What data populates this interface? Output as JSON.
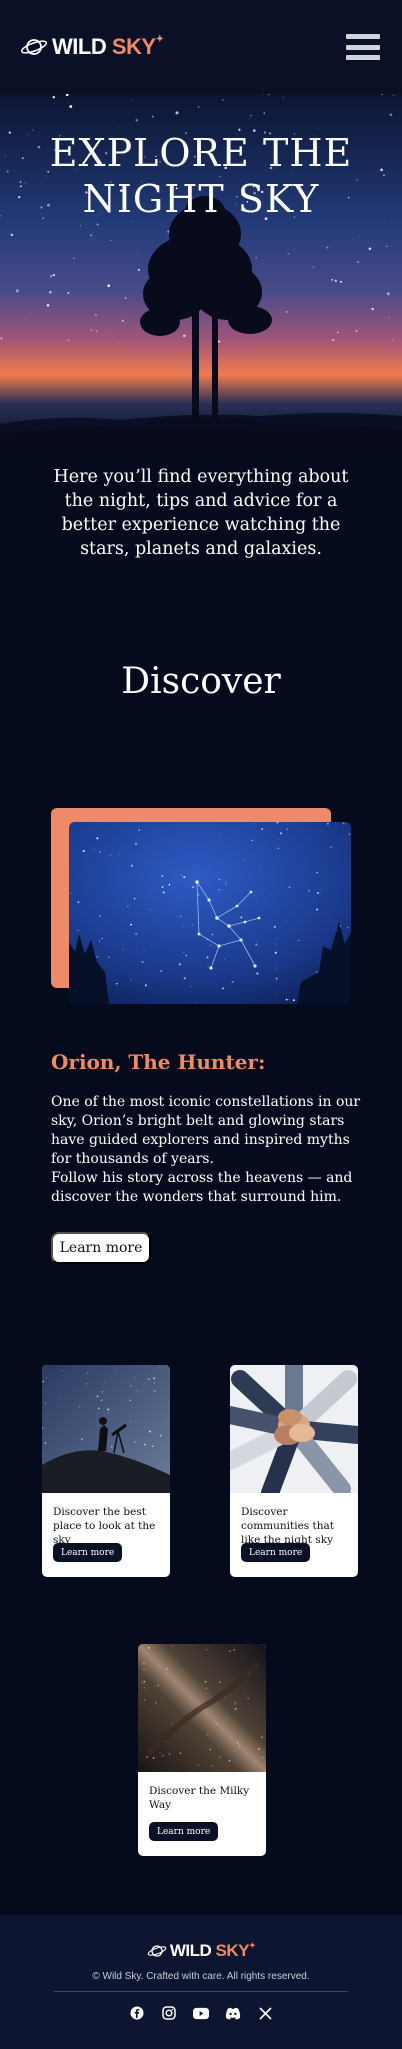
{
  "brand": {
    "first": "WILD",
    "second": "SKY"
  },
  "hero": {
    "title_line1": "EXPLORE THE",
    "title_line2": "NIGHT SKY",
    "description": "Here you’ll find everything about the night, tips and advice for a better experience watching the stars, planets and galaxies."
  },
  "discover": {
    "title": "Discover",
    "feature_title": "Orion, The Hunter:",
    "feature_text_1": "One of the most iconic constellations in our sky, Orion’s bright belt and glowing stars have guided explorers and inspired myths for thousands of years.",
    "feature_text_2": "Follow his story across the heavens — and discover the wonders that surround him.",
    "feature_button": "Learn more"
  },
  "cards": [
    {
      "text": "Discover the best place to look at the sky",
      "button": "Learn more"
    },
    {
      "text": "Discover communities that like the night sky",
      "button": "Learn more"
    },
    {
      "text": "Discover the Milky Way",
      "button": "Learn more"
    }
  ],
  "footer": {
    "copyright": "© Wild Sky. Crafted with care. All rights reserved.",
    "social_icons": [
      "facebook-icon",
      "instagram-icon",
      "youtube-icon",
      "discord-icon",
      "x-icon"
    ]
  },
  "colors": {
    "background": "#050b1d",
    "header": "#0a1127",
    "accent": "#f08a63",
    "card_button": "#0a1127"
  }
}
